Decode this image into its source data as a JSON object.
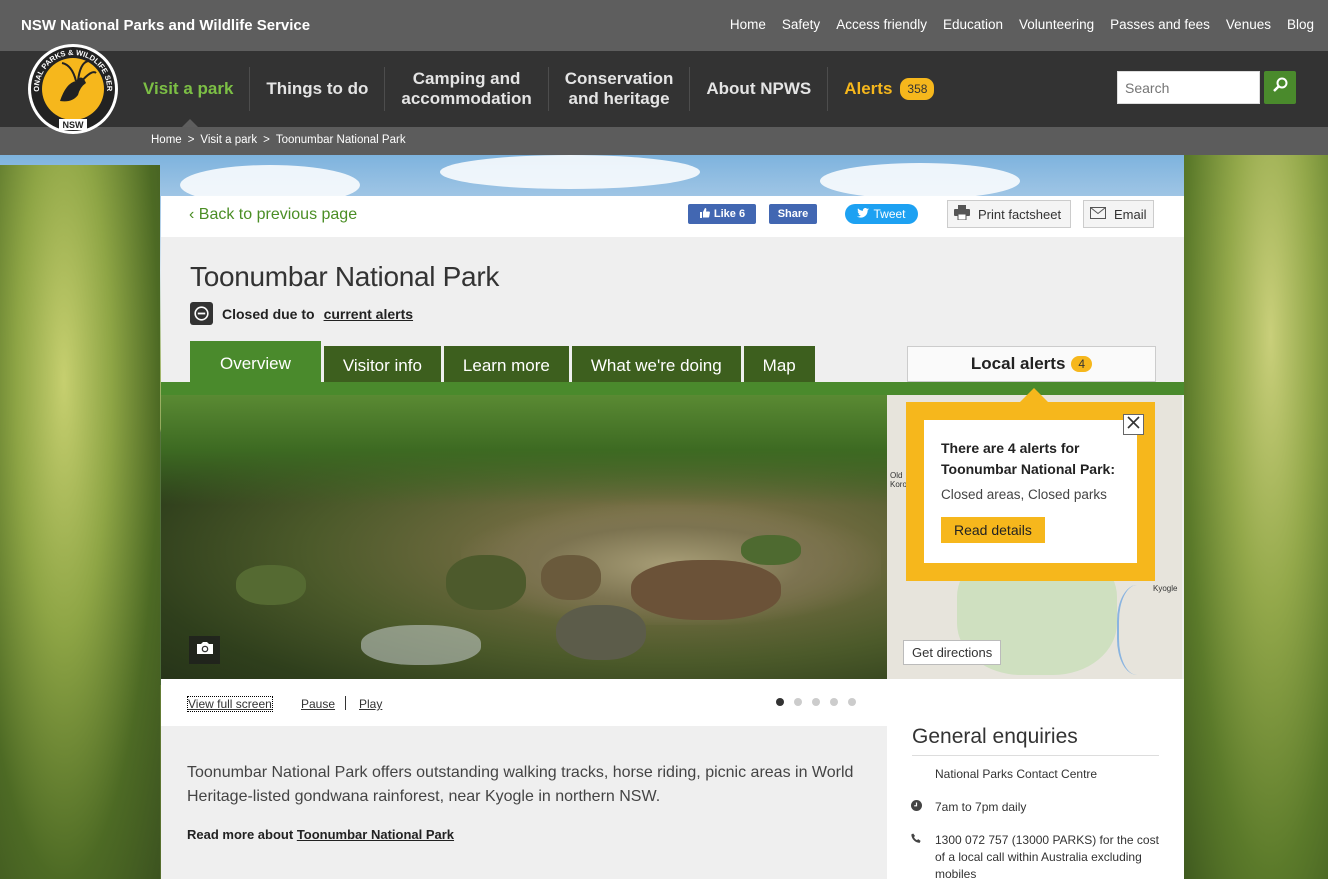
{
  "utility": {
    "site_name": "NSW National Parks and Wildlife Service",
    "links": [
      "Home",
      "Safety",
      "Access friendly",
      "Education",
      "Volunteering",
      "Passes and fees",
      "Venues",
      "Blog"
    ]
  },
  "logo": {
    "top_text": "NATIONAL PARKS & WILDLIFE SERVICE",
    "bottom_text": "NSW"
  },
  "nav": {
    "visit": "Visit a park",
    "things": "Things to do",
    "camping_1": "Camping and",
    "camping_2": "accommodation",
    "conservation_1": "Conservation",
    "conservation_2": "and heritage",
    "about": "About NPWS",
    "alerts": "Alerts",
    "alerts_count": "358",
    "search_placeholder": "Search"
  },
  "breadcrumb": {
    "items": [
      "Home",
      "Visit a park",
      "Toonumbar National Park"
    ],
    "separator": ">"
  },
  "toolbar": {
    "back": "Back to previous page",
    "fb_like": "Like 6",
    "fb_share": "Share",
    "tweet": "Tweet",
    "print": "Print factsheet",
    "email": "Email"
  },
  "park": {
    "title": "Toonumbar National Park",
    "closed_prefix": "Closed due to",
    "closed_link": "current alerts"
  },
  "tabs": [
    "Overview",
    "Visitor info",
    "Learn more",
    "What we're doing",
    "Map"
  ],
  "local_alerts": {
    "label": "Local alerts",
    "count": "4"
  },
  "popup": {
    "title": "There are 4 alerts for Toonumbar National Park:",
    "types": "Closed areas, Closed parks",
    "button": "Read details"
  },
  "map": {
    "label_1": "Old",
    "label_2": "Koro",
    "label_3": "Kyogle",
    "directions": "Get directions"
  },
  "slideshow": {
    "full_screen": "View full screen",
    "pause": "Pause",
    "play": "Play",
    "slide_count": 5,
    "active_slide": 1
  },
  "intro": {
    "text": "Toonumbar National Park offers outstanding walking tracks, horse riding, picnic areas in World Heritage-listed gondwana rainforest, near Kyogle in northern NSW.",
    "read_more_prefix": "Read more about",
    "read_more_link": "Toonumbar National Park"
  },
  "enquiries": {
    "title": "General enquiries",
    "contact": "National Parks Contact Centre",
    "hours": "7am to 7pm daily",
    "phone": "1300 072 757 (13000 PARKS) for the cost of a local call within Australia excluding mobiles"
  },
  "colors": {
    "green": "#4a8a2c",
    "dark_green": "#3d5f1e",
    "accent_yellow": "#f6b71c",
    "nav_bg": "#333333",
    "util_bg": "#5e5e5e"
  }
}
